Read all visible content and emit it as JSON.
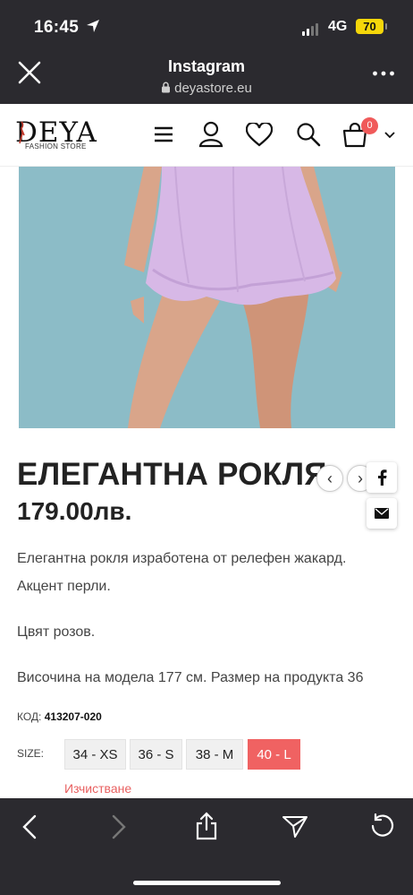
{
  "status_bar": {
    "time": "16:45",
    "network": "4G",
    "battery": "70"
  },
  "browser": {
    "title": "Instagram",
    "url": "deyastore.eu"
  },
  "site": {
    "logo": "DEYA",
    "logo_subtitle": "FASHION STORE",
    "cart_count": "0"
  },
  "product": {
    "title": "ЕЛЕГАНТНА РОКЛЯ",
    "price": "179.00лв.",
    "description": [
      "Елегантна рокля изработена от релефен жакард.",
      "Акцент перли.",
      "Цвят розов.",
      "Височина на модела 177 см. Размер на продукта 36"
    ],
    "code_label": "КОД:",
    "code": "413207-020",
    "size_label": "SIZE:",
    "sizes": [
      "34 - XS",
      "36 - S",
      "38 - M",
      "40 - L"
    ],
    "selected_size": "40 - L",
    "clear_label": "Изчистване"
  },
  "nav": {
    "prev": "‹",
    "next": "›"
  },
  "colors": {
    "dark_bar": "#2b2a2f",
    "accent": "#f06262",
    "badge": "#f05a5a",
    "battery": "#f5d60a",
    "dress": "#d7b8e6",
    "backdrop": "#8cbcc7"
  },
  "icons": [
    "location-arrow-icon",
    "close-icon",
    "lock-icon",
    "more-icon",
    "menu-icon",
    "user-icon",
    "heart-icon",
    "search-icon",
    "cart-icon",
    "chevron-down-icon",
    "facebook-icon",
    "mail-icon",
    "back-icon",
    "forward-icon",
    "share-icon",
    "send-icon",
    "refresh-icon"
  ]
}
